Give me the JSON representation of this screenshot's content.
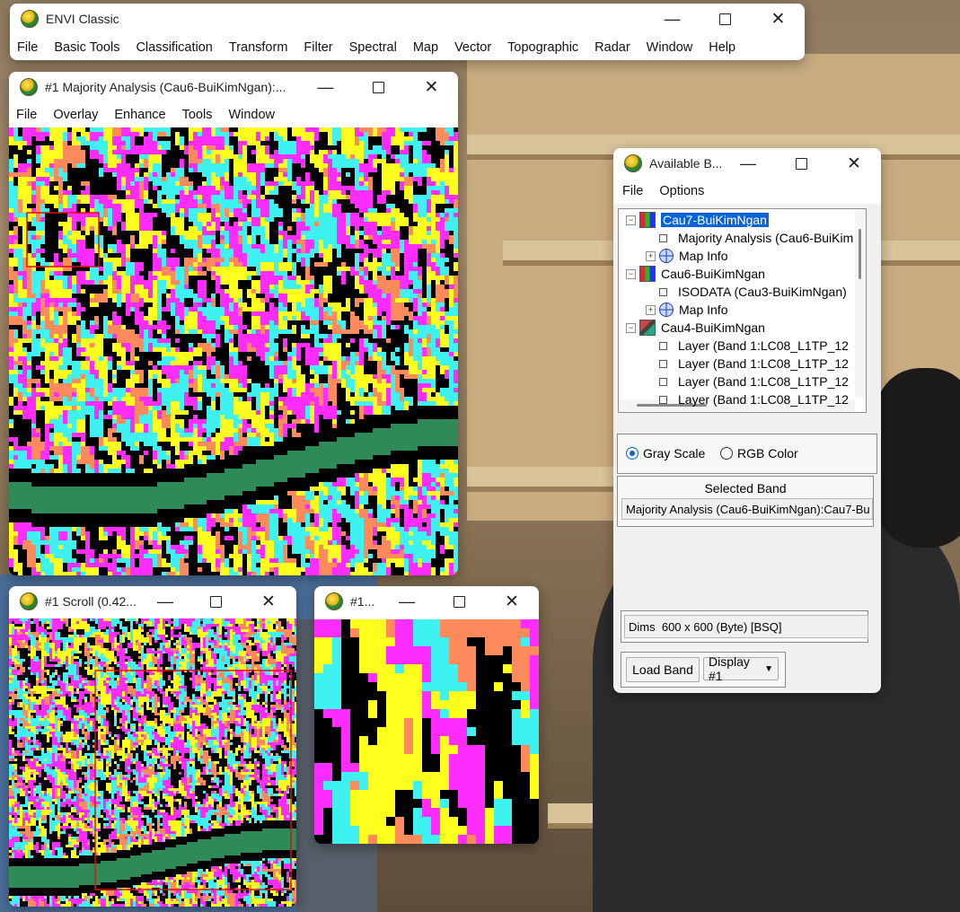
{
  "envi_main": {
    "title": "ENVI Classic",
    "menu": [
      "File",
      "Basic Tools",
      "Classification",
      "Transform",
      "Filter",
      "Spectral",
      "Map",
      "Vector",
      "Topographic",
      "Radar",
      "Window",
      "Help"
    ]
  },
  "image_window": {
    "title": "#1 Majority Analysis (Cau6-BuiKimNgan):...",
    "menu": [
      "File",
      "Overlay",
      "Enhance",
      "Tools",
      "Window"
    ]
  },
  "scroll_window": {
    "title": "#1 Scroll (0.42..."
  },
  "zoom_window": {
    "title": "#1..."
  },
  "available_bands": {
    "title": "Available B...",
    "menu": [
      "File",
      "Options"
    ],
    "tree": [
      {
        "label": "Cau7-BuiKimNgan",
        "kind": "file",
        "level": 0,
        "expander": "−",
        "selected": true
      },
      {
        "label": "Majority Analysis (Cau6-BuiKim",
        "kind": "band",
        "level": 1
      },
      {
        "label": "Map Info",
        "kind": "mapinfo",
        "level": 1,
        "expander": "+"
      },
      {
        "label": "Cau6-BuiKimNgan",
        "kind": "file",
        "level": 0,
        "expander": "−"
      },
      {
        "label": "ISODATA (Cau3-BuiKimNgan)",
        "kind": "band",
        "level": 1
      },
      {
        "label": "Map Info",
        "kind": "mapinfo",
        "level": 1,
        "expander": "+"
      },
      {
        "label": "Cau4-BuiKimNgan",
        "kind": "stack",
        "level": 0,
        "expander": "−"
      },
      {
        "label": "Layer (Band 1:LC08_L1TP_12",
        "kind": "band",
        "level": 1
      },
      {
        "label": "Layer (Band 1:LC08_L1TP_12",
        "kind": "band",
        "level": 1
      },
      {
        "label": "Layer (Band 1:LC08_L1TP_12",
        "kind": "band",
        "level": 1
      },
      {
        "label": "Layer (Band 1:LC08_L1TP_12",
        "kind": "band",
        "level": 1
      }
    ],
    "mode_gray": "Gray Scale",
    "mode_rgb": "RGB Color",
    "mode_selected": "Gray Scale",
    "selected_band_heading": "Selected Band",
    "selected_band_value": "Majority Analysis (Cau6-BuiKimNgan):Cau7-Bu",
    "dims_label": "Dims",
    "dims_value": "600 x 600 (Byte) [BSQ]",
    "load_button": "Load Band",
    "display_select": "Display #1"
  },
  "class_colors": {
    "black": "#000000",
    "magenta": "#ff2cff",
    "cyan": "#3ef2f2",
    "yellow": "#ffff1e",
    "coral": "#ff8a5c",
    "sea_green": "#2e8b57"
  },
  "accent_color": "#0a64d8"
}
